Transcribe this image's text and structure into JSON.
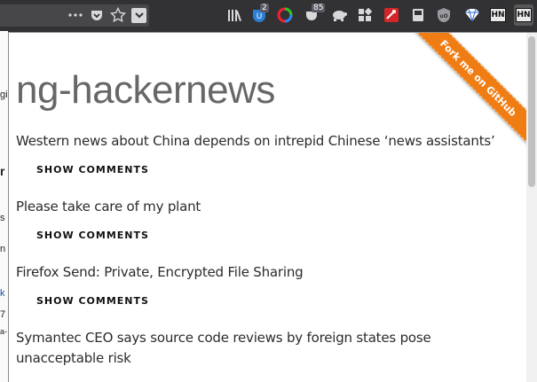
{
  "toolbar": {
    "icons": [
      "more-icon",
      "pocket-icon",
      "bookmark-star-icon",
      "dropdown-icon",
      "library-icon",
      "ublock-shield-icon",
      "color-wheel-icon",
      "pocket-count-icon",
      "turtle-icon",
      "grid-icon",
      "pdf-icon",
      "notebook-icon",
      "ublock-origin-icon",
      "vpn-icon",
      "hn-icon"
    ],
    "extension_badge": "2",
    "pocket_badge": "85",
    "hn_label": "HN",
    "hn_active_label": "HN",
    "colors": {
      "toolbar": "#323234",
      "urlbar": "#474749"
    }
  },
  "background_page": {
    "fragments": [
      "gi",
      "r",
      "s",
      "n",
      "k",
      "7",
      "a-"
    ]
  },
  "panel": {
    "title": "ng-hackernews",
    "ribbon": "Fork me on GitHub",
    "ribbon_color": "#f07d14",
    "stories": [
      {
        "title": "Western news about China depends on intrepid Chinese ‘news assistants’",
        "action": "SHOW COMMENTS"
      },
      {
        "title": "Please take care of my plant",
        "action": "SHOW COMMENTS"
      },
      {
        "title": "Firefox Send: Private, Encrypted File Sharing",
        "action": "SHOW COMMENTS"
      },
      {
        "title": "Symantec CEO says source code reviews by foreign states pose unacceptable risk",
        "action": ""
      }
    ]
  }
}
